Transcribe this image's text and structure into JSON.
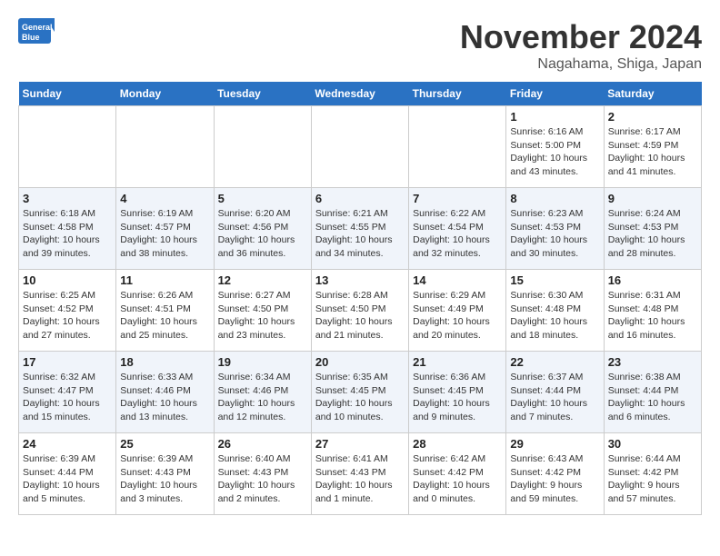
{
  "logo": {
    "line1": "General",
    "line2": "Blue"
  },
  "title": "November 2024",
  "location": "Nagahama, Shiga, Japan",
  "weekdays": [
    "Sunday",
    "Monday",
    "Tuesday",
    "Wednesday",
    "Thursday",
    "Friday",
    "Saturday"
  ],
  "weeks": [
    [
      {
        "day": "",
        "info": ""
      },
      {
        "day": "",
        "info": ""
      },
      {
        "day": "",
        "info": ""
      },
      {
        "day": "",
        "info": ""
      },
      {
        "day": "",
        "info": ""
      },
      {
        "day": "1",
        "info": "Sunrise: 6:16 AM\nSunset: 5:00 PM\nDaylight: 10 hours\nand 43 minutes."
      },
      {
        "day": "2",
        "info": "Sunrise: 6:17 AM\nSunset: 4:59 PM\nDaylight: 10 hours\nand 41 minutes."
      }
    ],
    [
      {
        "day": "3",
        "info": "Sunrise: 6:18 AM\nSunset: 4:58 PM\nDaylight: 10 hours\nand 39 minutes."
      },
      {
        "day": "4",
        "info": "Sunrise: 6:19 AM\nSunset: 4:57 PM\nDaylight: 10 hours\nand 38 minutes."
      },
      {
        "day": "5",
        "info": "Sunrise: 6:20 AM\nSunset: 4:56 PM\nDaylight: 10 hours\nand 36 minutes."
      },
      {
        "day": "6",
        "info": "Sunrise: 6:21 AM\nSunset: 4:55 PM\nDaylight: 10 hours\nand 34 minutes."
      },
      {
        "day": "7",
        "info": "Sunrise: 6:22 AM\nSunset: 4:54 PM\nDaylight: 10 hours\nand 32 minutes."
      },
      {
        "day": "8",
        "info": "Sunrise: 6:23 AM\nSunset: 4:53 PM\nDaylight: 10 hours\nand 30 minutes."
      },
      {
        "day": "9",
        "info": "Sunrise: 6:24 AM\nSunset: 4:53 PM\nDaylight: 10 hours\nand 28 minutes."
      }
    ],
    [
      {
        "day": "10",
        "info": "Sunrise: 6:25 AM\nSunset: 4:52 PM\nDaylight: 10 hours\nand 27 minutes."
      },
      {
        "day": "11",
        "info": "Sunrise: 6:26 AM\nSunset: 4:51 PM\nDaylight: 10 hours\nand 25 minutes."
      },
      {
        "day": "12",
        "info": "Sunrise: 6:27 AM\nSunset: 4:50 PM\nDaylight: 10 hours\nand 23 minutes."
      },
      {
        "day": "13",
        "info": "Sunrise: 6:28 AM\nSunset: 4:50 PM\nDaylight: 10 hours\nand 21 minutes."
      },
      {
        "day": "14",
        "info": "Sunrise: 6:29 AM\nSunset: 4:49 PM\nDaylight: 10 hours\nand 20 minutes."
      },
      {
        "day": "15",
        "info": "Sunrise: 6:30 AM\nSunset: 4:48 PM\nDaylight: 10 hours\nand 18 minutes."
      },
      {
        "day": "16",
        "info": "Sunrise: 6:31 AM\nSunset: 4:48 PM\nDaylight: 10 hours\nand 16 minutes."
      }
    ],
    [
      {
        "day": "17",
        "info": "Sunrise: 6:32 AM\nSunset: 4:47 PM\nDaylight: 10 hours\nand 15 minutes."
      },
      {
        "day": "18",
        "info": "Sunrise: 6:33 AM\nSunset: 4:46 PM\nDaylight: 10 hours\nand 13 minutes."
      },
      {
        "day": "19",
        "info": "Sunrise: 6:34 AM\nSunset: 4:46 PM\nDaylight: 10 hours\nand 12 minutes."
      },
      {
        "day": "20",
        "info": "Sunrise: 6:35 AM\nSunset: 4:45 PM\nDaylight: 10 hours\nand 10 minutes."
      },
      {
        "day": "21",
        "info": "Sunrise: 6:36 AM\nSunset: 4:45 PM\nDaylight: 10 hours\nand 9 minutes."
      },
      {
        "day": "22",
        "info": "Sunrise: 6:37 AM\nSunset: 4:44 PM\nDaylight: 10 hours\nand 7 minutes."
      },
      {
        "day": "23",
        "info": "Sunrise: 6:38 AM\nSunset: 4:44 PM\nDaylight: 10 hours\nand 6 minutes."
      }
    ],
    [
      {
        "day": "24",
        "info": "Sunrise: 6:39 AM\nSunset: 4:44 PM\nDaylight: 10 hours\nand 5 minutes."
      },
      {
        "day": "25",
        "info": "Sunrise: 6:39 AM\nSunset: 4:43 PM\nDaylight: 10 hours\nand 3 minutes."
      },
      {
        "day": "26",
        "info": "Sunrise: 6:40 AM\nSunset: 4:43 PM\nDaylight: 10 hours\nand 2 minutes."
      },
      {
        "day": "27",
        "info": "Sunrise: 6:41 AM\nSunset: 4:43 PM\nDaylight: 10 hours\nand 1 minute."
      },
      {
        "day": "28",
        "info": "Sunrise: 6:42 AM\nSunset: 4:42 PM\nDaylight: 10 hours\nand 0 minutes."
      },
      {
        "day": "29",
        "info": "Sunrise: 6:43 AM\nSunset: 4:42 PM\nDaylight: 9 hours\nand 59 minutes."
      },
      {
        "day": "30",
        "info": "Sunrise: 6:44 AM\nSunset: 4:42 PM\nDaylight: 9 hours\nand 57 minutes."
      }
    ]
  ]
}
